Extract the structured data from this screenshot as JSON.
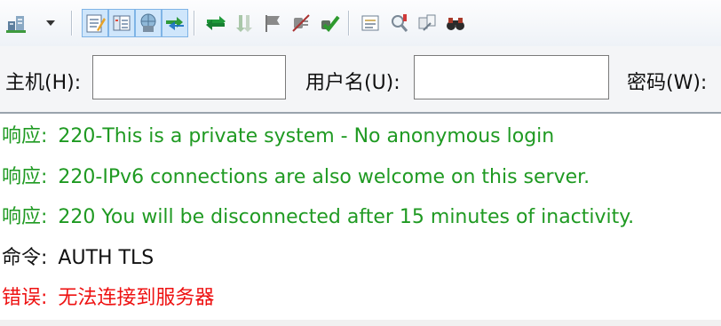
{
  "colors": {
    "response": "#1f9a22",
    "command": "#111111",
    "error": "#ee1111"
  },
  "toolbar": {
    "buttons": [
      {
        "icon": "site-manager-icon",
        "pressed": false
      },
      {
        "icon": "message-log-toggle-icon",
        "pressed": true
      },
      {
        "icon": "local-tree-toggle-icon",
        "pressed": true
      },
      {
        "icon": "remote-tree-toggle-icon",
        "pressed": true
      },
      {
        "icon": "transfer-queue-toggle-icon",
        "pressed": true
      },
      {
        "icon": "refresh-icon",
        "pressed": false
      },
      {
        "icon": "process-queue-icon",
        "pressed": false
      },
      {
        "icon": "cancel-operation-icon",
        "pressed": false
      },
      {
        "icon": "disconnect-icon",
        "pressed": false
      },
      {
        "icon": "reconnect-icon",
        "pressed": false
      },
      {
        "icon": "directory-filter-icon",
        "pressed": false
      },
      {
        "icon": "directory-comparison-icon",
        "pressed": false
      },
      {
        "icon": "synchronized-browsing-icon",
        "pressed": false
      },
      {
        "icon": "search-remote-files-icon",
        "pressed": false
      }
    ]
  },
  "quickconnect": {
    "host_label": "主机(H):",
    "host_value": "",
    "username_label": "用户名(U):",
    "username_value": "",
    "password_label": "密码(W):"
  },
  "log": [
    {
      "type": "response",
      "prefix": "响应:",
      "text": "220-This is a private system - No anonymous login"
    },
    {
      "type": "response",
      "prefix": "响应:",
      "text": "220-IPv6 connections are also welcome on this server."
    },
    {
      "type": "response",
      "prefix": "响应:",
      "text": "220 You will be disconnected after 15 minutes of inactivity."
    },
    {
      "type": "command",
      "prefix": "命令:",
      "text": "AUTH TLS"
    },
    {
      "type": "error",
      "prefix": "错误:",
      "text": "无法连接到服务器"
    }
  ]
}
